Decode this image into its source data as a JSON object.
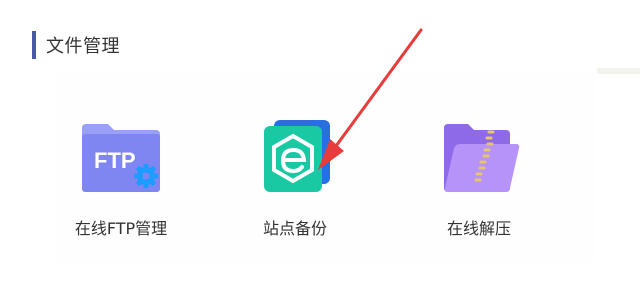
{
  "section": {
    "title": "文件管理"
  },
  "tools": [
    {
      "label": "在线FTP管理",
      "icon": "ftp-folder-icon",
      "icon_text": "FTP"
    },
    {
      "label": "站点备份",
      "icon": "site-backup-icon"
    },
    {
      "label": "在线解压",
      "icon": "zip-folder-icon"
    }
  ],
  "colors": {
    "section_bar": "#4a58a8",
    "ftp_folder": "#7f86f2",
    "ftp_gear": "#1e9bff",
    "backup_green": "#19c9a3",
    "backup_blue": "#2a6fe0",
    "zip_purple": "#a77ff4",
    "zip_zipper": "#e7c56a",
    "arrow_red": "#e83c3c"
  }
}
